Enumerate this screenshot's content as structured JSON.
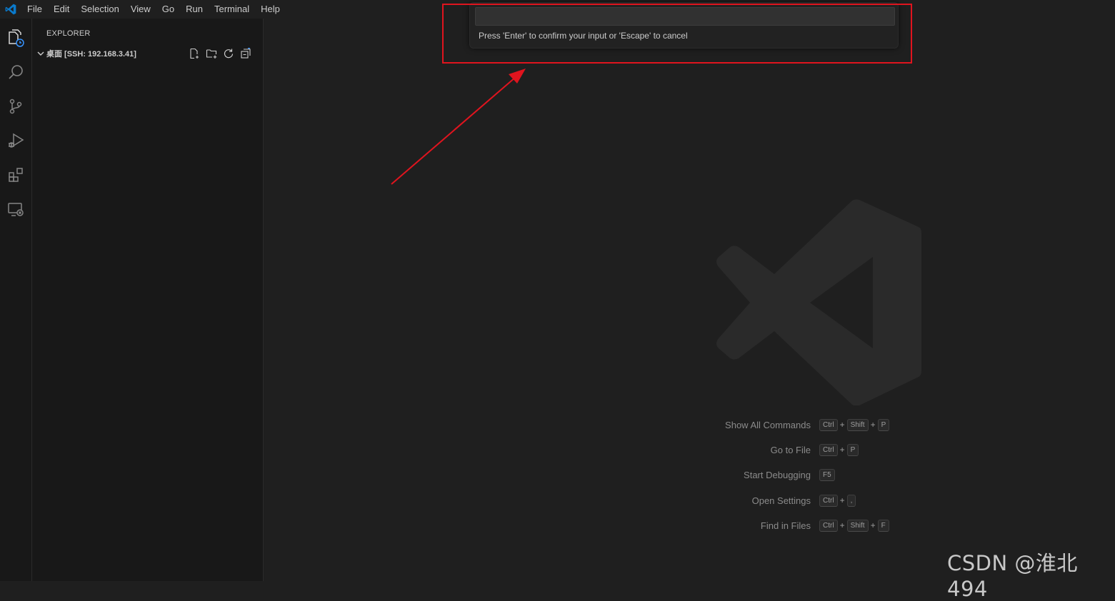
{
  "menu": {
    "items": [
      "File",
      "Edit",
      "Selection",
      "View",
      "Go",
      "Run",
      "Terminal",
      "Help"
    ]
  },
  "activity_bar": {
    "icons": [
      "explorer-icon",
      "search-icon",
      "source-control-icon",
      "run-debug-icon",
      "extensions-icon",
      "remote-explorer-icon"
    ]
  },
  "sidebar": {
    "title": "EXPLORER",
    "folder_name": "桌面 [SSH: 192.168.3.41]",
    "actions": [
      "new-file-icon",
      "new-folder-icon",
      "refresh-icon",
      "collapse-all-icon"
    ]
  },
  "quick_input": {
    "value": "",
    "message": "Press 'Enter' to confirm your input or 'Escape' to cancel"
  },
  "shortcuts": [
    {
      "label": "Show All Commands",
      "keys": [
        "Ctrl",
        "Shift",
        "P"
      ]
    },
    {
      "label": "Go to File",
      "keys": [
        "Ctrl",
        "P"
      ]
    },
    {
      "label": "Start Debugging",
      "keys": [
        "F5"
      ]
    },
    {
      "label": "Open Settings",
      "keys": [
        "Ctrl",
        ","
      ]
    },
    {
      "label": "Find in Files",
      "keys": [
        "Ctrl",
        "Shift",
        "F"
      ]
    }
  ],
  "watermark_text": "CSDN @淮北494",
  "colors": {
    "accent": "#0078d4",
    "annotation": "#e0141e",
    "background": "#1f1f1f",
    "sidebar": "#181818"
  }
}
